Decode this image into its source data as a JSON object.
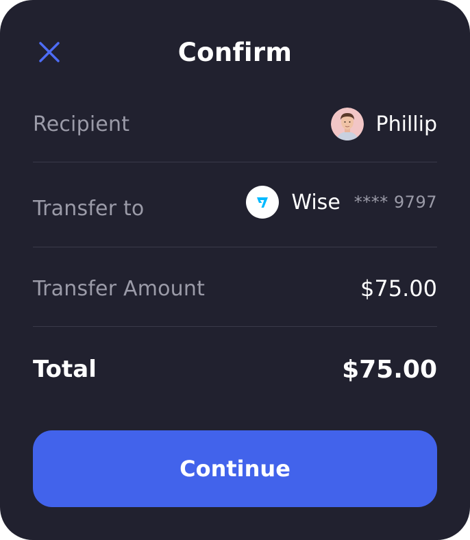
{
  "header": {
    "title": "Confirm",
    "close_icon": "close-icon"
  },
  "recipient": {
    "label": "Recipient",
    "name": "Phillip",
    "avatar_icon": "avatar"
  },
  "transfer_to": {
    "label": "Transfer to",
    "bank": "Wise",
    "account": "**** 9797",
    "logo_icon": "wise-logo-icon"
  },
  "amount": {
    "label": "Transfer Amount",
    "value": "$75.00"
  },
  "total": {
    "label": "Total",
    "value": "$75.00"
  },
  "actions": {
    "continue_label": "Continue"
  },
  "colors": {
    "background": "#21212f",
    "accent": "#4263eb",
    "close_icon": "#4d6cf5",
    "wise_brand": "#00b9ff",
    "muted_text": "#9b9ba8",
    "divider": "#3a3a4a"
  }
}
